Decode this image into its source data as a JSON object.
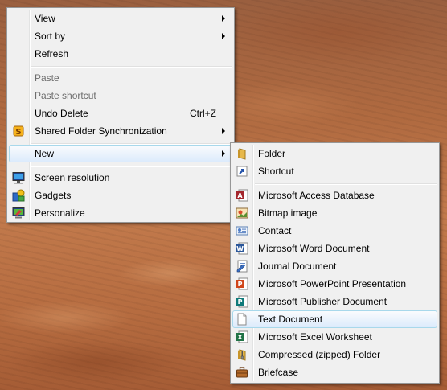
{
  "context_menu": {
    "items": {
      "view": {
        "label": "View",
        "icon": "none",
        "submenu": true
      },
      "sort_by": {
        "label": "Sort by",
        "icon": "none",
        "submenu": true
      },
      "refresh": {
        "label": "Refresh",
        "icon": "none"
      },
      "paste": {
        "label": "Paste",
        "enabled": false
      },
      "paste_shortcut": {
        "label": "Paste shortcut",
        "enabled": false
      },
      "undo_delete": {
        "label": "Undo Delete",
        "shortcut": "Ctrl+Z"
      },
      "shared_folder_sync": {
        "label": "Shared Folder Synchronization",
        "icon": "sync-icon",
        "submenu": true
      },
      "new": {
        "label": "New",
        "submenu": true,
        "highlighted": true
      },
      "screen_resolution": {
        "label": "Screen resolution",
        "icon": "monitor-icon"
      },
      "gadgets": {
        "label": "Gadgets",
        "icon": "gadgets-icon"
      },
      "personalize": {
        "label": "Personalize",
        "icon": "personalize-icon"
      }
    }
  },
  "new_submenu": {
    "items": [
      {
        "label": "Folder",
        "icon": "folder-icon"
      },
      {
        "label": "Shortcut",
        "icon": "shortcut-icon"
      },
      {
        "label": "Microsoft Access Database",
        "icon": "access-icon"
      },
      {
        "label": "Bitmap image",
        "icon": "bitmap-icon"
      },
      {
        "label": "Contact",
        "icon": "contact-icon"
      },
      {
        "label": "Microsoft Word Document",
        "icon": "word-icon"
      },
      {
        "label": "Journal Document",
        "icon": "journal-icon"
      },
      {
        "label": "Microsoft PowerPoint Presentation",
        "icon": "powerpoint-icon"
      },
      {
        "label": "Microsoft Publisher Document",
        "icon": "publisher-icon"
      },
      {
        "label": "Text Document",
        "icon": "text-document-icon",
        "highlighted": true
      },
      {
        "label": "Microsoft Excel Worksheet",
        "icon": "excel-icon"
      },
      {
        "label": "Compressed (zipped) Folder",
        "icon": "zip-folder-icon"
      },
      {
        "label": "Briefcase",
        "icon": "briefcase-icon"
      }
    ]
  }
}
